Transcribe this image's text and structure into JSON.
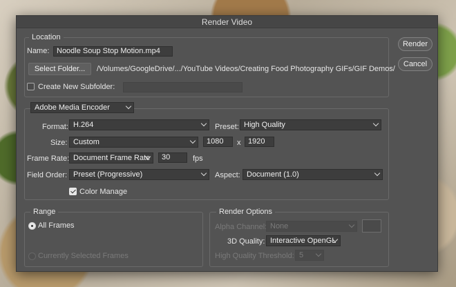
{
  "dialog": {
    "title": "Render Video",
    "render_button": "Render",
    "cancel_button": "Cancel"
  },
  "location": {
    "legend": "Location",
    "name_label": "Name:",
    "name_value": "Noodle Soup Stop Motion.mp4",
    "select_folder_button": "Select Folder...",
    "folder_path": "/Volumes/GoogleDrive/.../YouTube Videos/Creating Food Photography GIFs/GIF Demos/",
    "create_subfolder_label": "Create New Subfolder:",
    "create_subfolder_checked": false,
    "subfolder_value": ""
  },
  "encoder": {
    "selected": "Adobe Media Encoder",
    "format_label": "Format:",
    "format_value": "H.264",
    "preset_label": "Preset:",
    "preset_value": "High Quality",
    "size_label": "Size:",
    "size_value": "Custom",
    "width_value": "1080",
    "size_x": "x",
    "height_value": "1920",
    "frame_rate_label": "Frame Rate:",
    "frame_rate_value": "Document Frame Rate",
    "fps_value": "30",
    "fps_unit": "fps",
    "field_order_label": "Field Order:",
    "field_order_value": "Preset (Progressive)",
    "aspect_label": "Aspect:",
    "aspect_value": "Document (1.0)",
    "color_manage_label": "Color Manage",
    "color_manage_checked": true
  },
  "range": {
    "legend": "Range",
    "all_frames_label": "All Frames",
    "all_frames_selected": true,
    "currently_selected_label": "Currently Selected Frames"
  },
  "render_options": {
    "legend": "Render Options",
    "alpha_channel_label": "Alpha Channel:",
    "alpha_channel_value": "None",
    "quality_3d_label": "3D Quality:",
    "quality_3d_value": "Interactive OpenGL",
    "hq_threshold_label": "High Quality Threshold:",
    "hq_threshold_value": "5"
  }
}
